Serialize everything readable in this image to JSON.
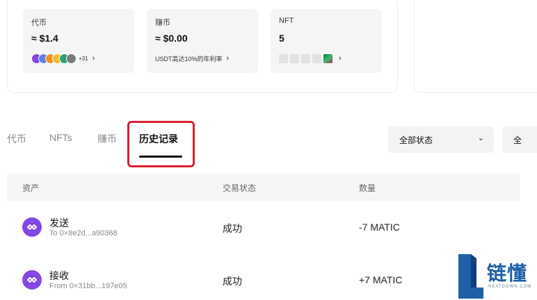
{
  "assets": {
    "tokens": {
      "label": "代币",
      "value": "≈ $1.4",
      "more_count": "+31",
      "coin_icons": [
        "matic-icon",
        "eth-icon",
        "btc-icon",
        "bnb-icon",
        "usdt-icon",
        "ltc-icon"
      ]
    },
    "earn": {
      "label": "赚币",
      "value": "≈ $0.00",
      "promo": "USDT高达10%的年利率"
    },
    "nft": {
      "label": "NFT",
      "value": "5"
    }
  },
  "tabs": [
    {
      "label": "代币"
    },
    {
      "label": "NFTs"
    },
    {
      "label": "赚币"
    },
    {
      "label": "历史记录",
      "active": true
    }
  ],
  "filters": {
    "status": "全部状态",
    "second": "全"
  },
  "table": {
    "columns": [
      "资产",
      "交易状态",
      "数量"
    ],
    "rows": [
      {
        "type": "发送",
        "address": "To 0×8e2d...a90368",
        "status": "成功",
        "amount": "-7 MATIC",
        "icon": "polygon-icon"
      },
      {
        "type": "接收",
        "address": "From 0×31bb...197e05",
        "status": "成功",
        "amount": "+7 MATIC",
        "icon": "polygon-icon"
      }
    ]
  },
  "watermark": {
    "text": "链懂",
    "sub": "NEATDOWN.COM"
  },
  "colors": {
    "highlight": "#d7202f",
    "polygon": "#8247e5",
    "brand_blue": "#1e5fa8"
  }
}
